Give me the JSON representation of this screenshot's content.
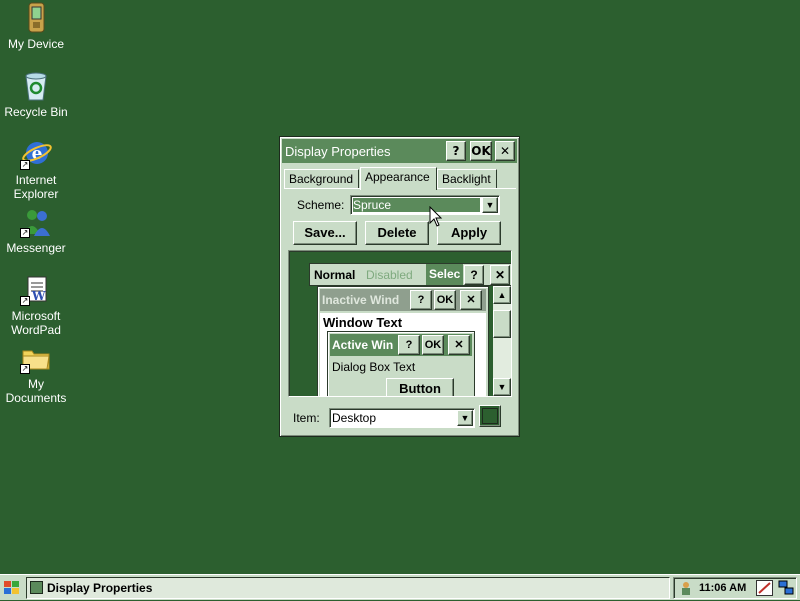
{
  "desktop": {
    "icons": [
      {
        "label": "My Device",
        "icon": "pda-device-icon"
      },
      {
        "label": "Recycle Bin",
        "icon": "recycle-bin-icon"
      },
      {
        "label": "Internet Explorer",
        "icon": "internet-explorer-icon"
      },
      {
        "label": "Messenger",
        "icon": "messenger-icon"
      },
      {
        "label": "Microsoft WordPad",
        "icon": "wordpad-icon"
      },
      {
        "label": "My Documents",
        "icon": "folder-icon"
      }
    ],
    "background_color": "#2c5f2f"
  },
  "dialog": {
    "title": "Display Properties",
    "help_label": "?",
    "ok_label": "OK",
    "close_label": "✕",
    "tabs": [
      {
        "label": "Background",
        "active": false
      },
      {
        "label": "Appearance",
        "active": true
      },
      {
        "label": "Backlight",
        "active": false
      }
    ],
    "scheme_label": "Scheme:",
    "scheme_value": "Spruce",
    "buttons": {
      "save": "Save...",
      "delete": "Delete",
      "apply": "Apply"
    },
    "preview": {
      "menu_normal": "Normal",
      "menu_disabled": "Disabled",
      "menu_selected": "Selec",
      "inactive_title": "Inactive Wind",
      "window_text": "Window Text",
      "active_title": "Active Win",
      "dialog_text": "Dialog Box Text",
      "button_label": "Button",
      "help_label": "?",
      "ok_label": "OK",
      "close_label": "✕"
    },
    "item_label": "Item:",
    "item_value": "Desktop",
    "item_color": "#2c5f2f"
  },
  "taskbar": {
    "task_label": "Display Properties",
    "clock": "11:06 AM"
  }
}
